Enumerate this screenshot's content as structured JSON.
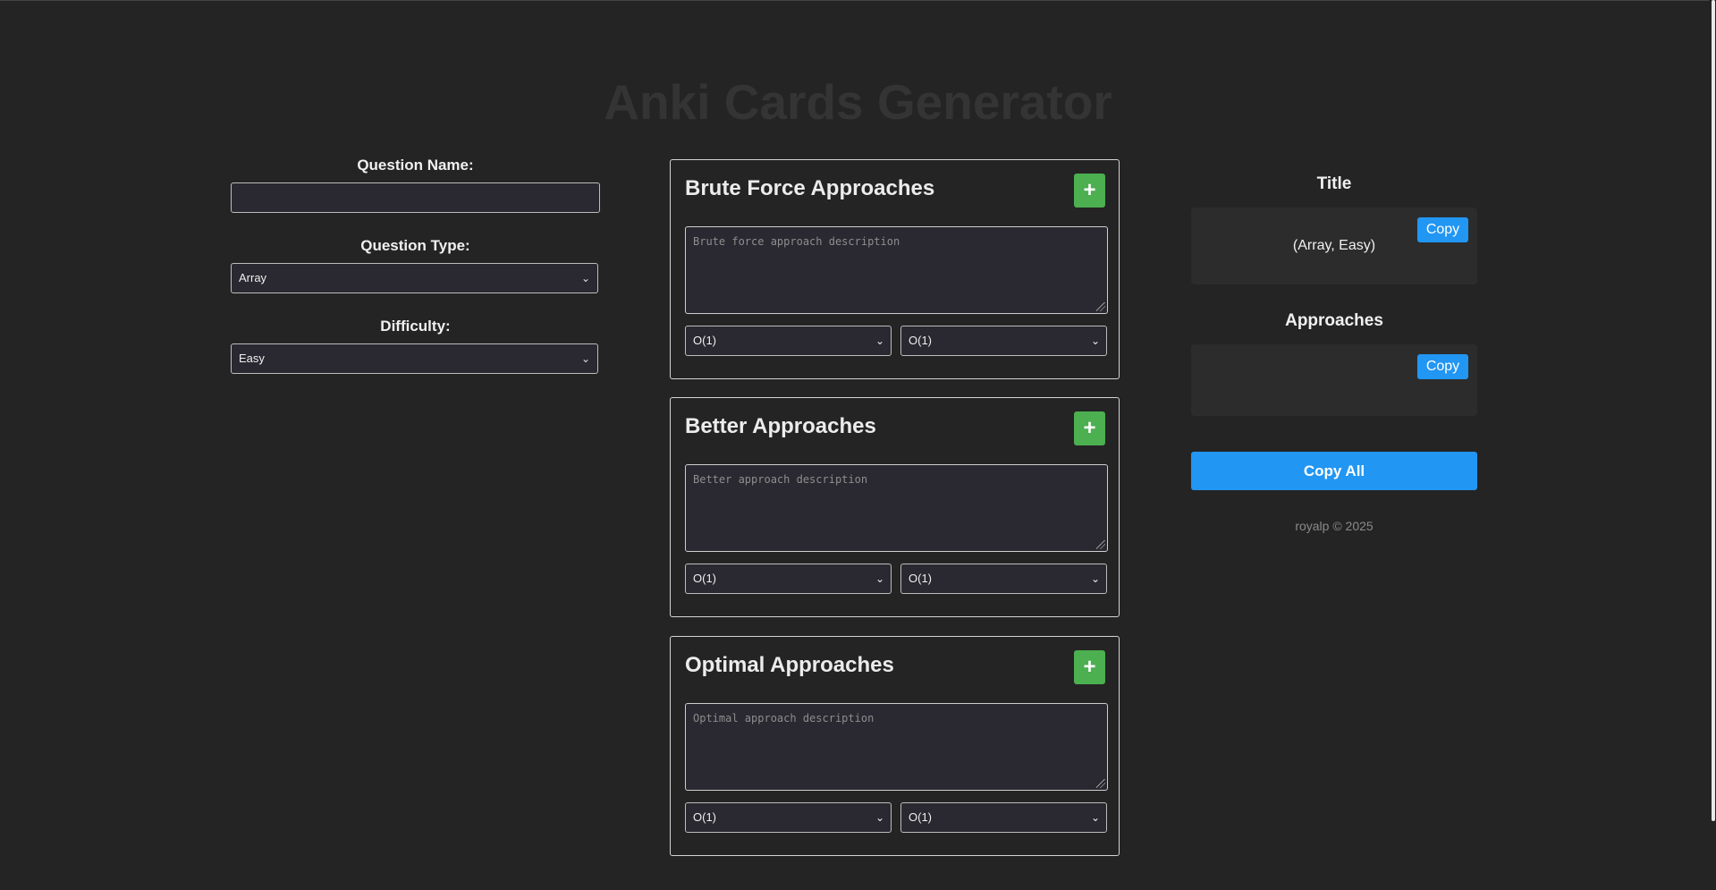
{
  "page": {
    "title": "Anki Cards Generator"
  },
  "form": {
    "question_name_label": "Question Name:",
    "question_name_value": "",
    "question_type_label": "Question Type:",
    "question_type_value": "Array",
    "difficulty_label": "Difficulty:",
    "difficulty_value": "Easy"
  },
  "approaches": [
    {
      "title": "Brute Force Approaches",
      "add_label": "+",
      "placeholder": "Brute force approach description",
      "time_complexity": "O(1)",
      "space_complexity": "O(1)"
    },
    {
      "title": "Better Approaches",
      "add_label": "+",
      "placeholder": "Better approach description",
      "time_complexity": "O(1)",
      "space_complexity": "O(1)"
    },
    {
      "title": "Optimal Approaches",
      "add_label": "+",
      "placeholder": "Optimal approach description",
      "time_complexity": "O(1)",
      "space_complexity": "O(1)"
    }
  ],
  "output": {
    "title_heading": "Title",
    "title_value": "(Array, Easy)",
    "approaches_heading": "Approaches",
    "approaches_value": "",
    "copy_label": "Copy",
    "copy_all_label": "Copy All",
    "footer": "royalp © 2025"
  },
  "icons": {
    "dropdown": "chevron-down-icon",
    "add": "plus-icon"
  },
  "colors": {
    "background": "#242424",
    "add_button": "#4caf50",
    "copy_button": "#2196f3"
  }
}
